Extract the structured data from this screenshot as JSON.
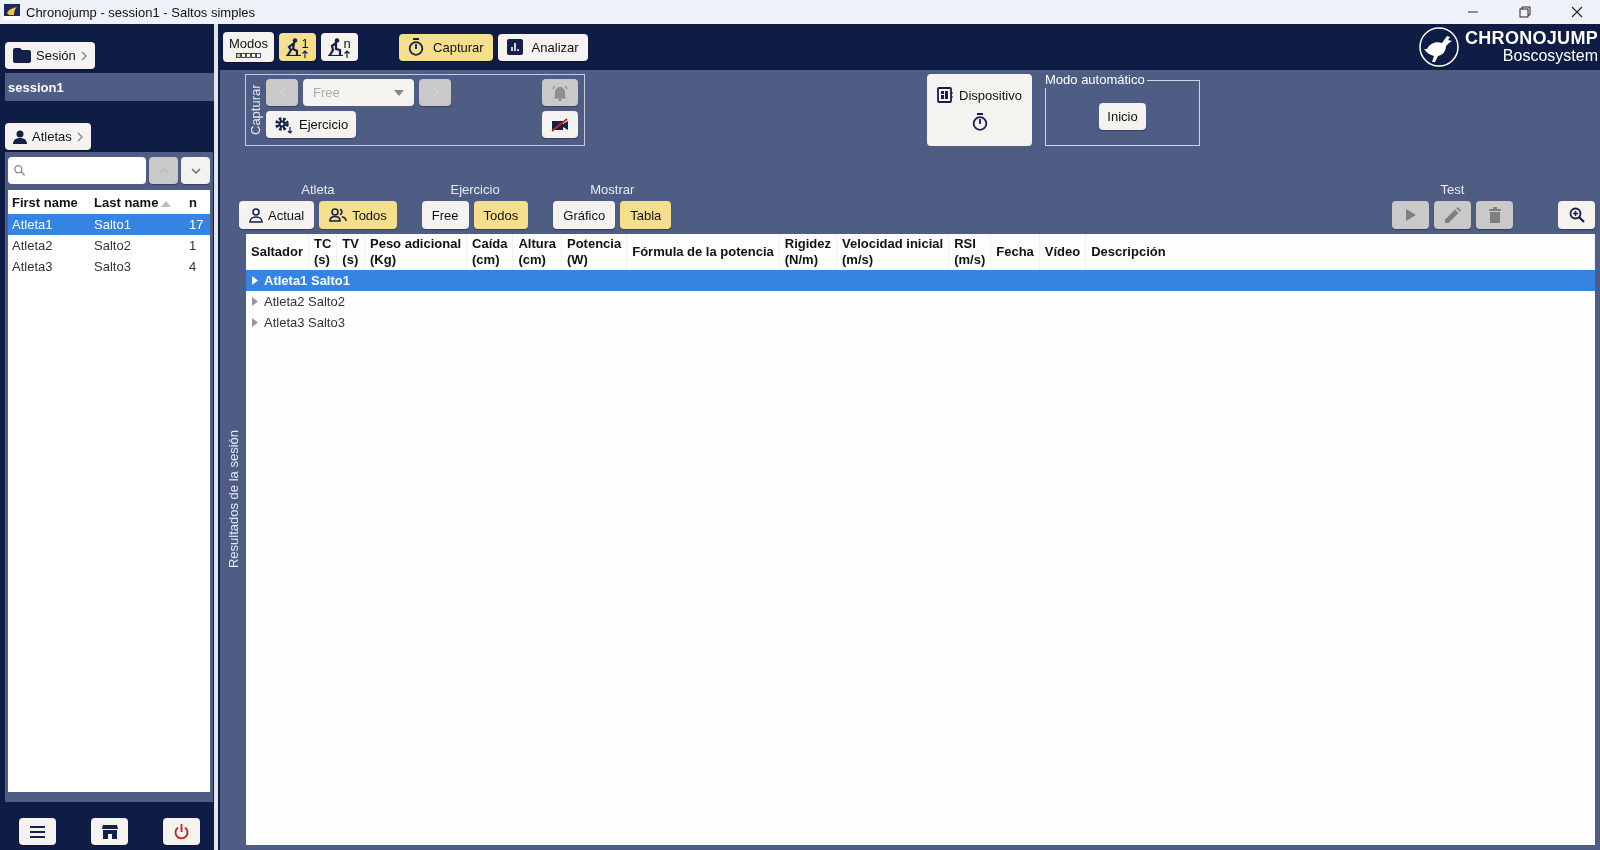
{
  "window": {
    "title": "Chronojump - session1 - Saltos simples"
  },
  "sidebar": {
    "session_button": "Sesión",
    "session_name": "session1",
    "athletes_button": "Atletas",
    "athletes_table": {
      "columns": [
        {
          "label": "First name",
          "sorted": false
        },
        {
          "label": "Last name",
          "sorted": true
        },
        {
          "label": "n",
          "sorted": false
        }
      ],
      "rows": [
        {
          "cells": [
            "Atleta1",
            "Salto1",
            "17"
          ],
          "selected": true
        },
        {
          "cells": [
            "Atleta2",
            "Salto2",
            "1"
          ],
          "selected": false
        },
        {
          "cells": [
            "Atleta3",
            "Salto3",
            "4"
          ],
          "selected": false
        }
      ]
    }
  },
  "toolbar": {
    "modes_button": "Modos",
    "jump_modes": [
      {
        "kind": "simple",
        "badge": "1",
        "selected": true
      },
      {
        "kind": "reactive",
        "badge": "n",
        "selected": false
      }
    ],
    "tabs": [
      {
        "kind": "capture",
        "label": "Capturar",
        "selected": true
      },
      {
        "kind": "analyze",
        "label": "Analizar",
        "selected": false
      }
    ],
    "logo": {
      "title": "CHRONOJUMP",
      "subtitle": "Boscosystem"
    }
  },
  "capture": {
    "label": "Capturar",
    "exercise_select": {
      "value": "Free",
      "disabled": true
    },
    "prev_disabled": true,
    "next_disabled": true,
    "exercise_button": "Ejercicio",
    "bell_disabled": true
  },
  "device": {
    "label": "Dispositivo"
  },
  "auto_mode": {
    "legend": "Modo automático",
    "button": "Inicio"
  },
  "filters": [
    {
      "label": "Atleta",
      "options": [
        {
          "label": "Actual",
          "kind": "person",
          "selected": false
        },
        {
          "label": "Todos",
          "kind": "people",
          "selected": true
        }
      ]
    },
    {
      "label": "Ejercicio",
      "options": [
        {
          "label": "Free",
          "selected": false
        },
        {
          "label": "Todos",
          "selected": true
        }
      ]
    },
    {
      "label": "Mostrar",
      "options": [
        {
          "label": "Gráfico",
          "selected": false
        },
        {
          "label": "Tabla",
          "selected": true
        }
      ]
    }
  ],
  "test": {
    "label": "Test",
    "buttons": [
      {
        "kind": "play",
        "disabled": true
      },
      {
        "kind": "edit",
        "disabled": true
      },
      {
        "kind": "delete",
        "disabled": true
      }
    ]
  },
  "results": {
    "label": "Resultados de la sesión",
    "columns": [
      "Saltador",
      "TC\n(s)",
      "TV\n(s)",
      "Peso adicional\n(Kg)",
      "Caída\n(cm)",
      "Altura\n(cm)",
      "Potencia\n(W)",
      "Fórmula de la potencia",
      "Rigidez\n(N/m)",
      "Velocidad inicial\n(m/s)",
      "RSI\n(m/s)",
      "Fecha",
      "Vídeo",
      "Descripción"
    ],
    "rows": [
      {
        "label": "Atleta1 Salto1",
        "selected": true
      },
      {
        "label": "Atleta2 Salto2",
        "selected": false
      },
      {
        "label": "Atleta3 Salto3",
        "selected": false
      }
    ]
  }
}
